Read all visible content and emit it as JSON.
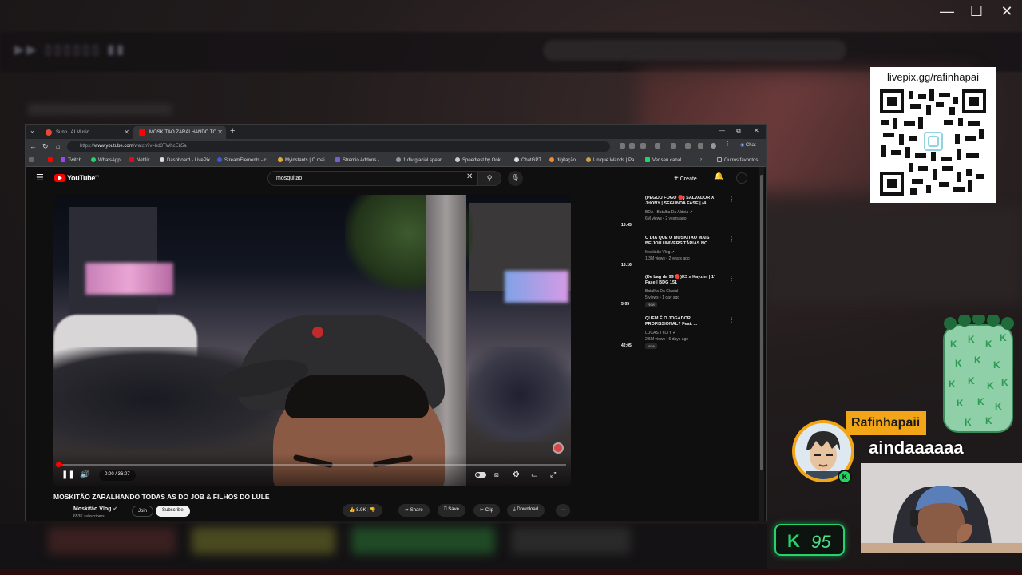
{
  "window_controls": {
    "minimize": "—",
    "maximize": "☐",
    "close": "✕"
  },
  "browser": {
    "tabs": [
      {
        "title": "Suno | AI Music",
        "active": false,
        "favicon_color": "#e24a3a"
      },
      {
        "title": "MOSKITÃO ZARALHANDO TO",
        "active": true,
        "favicon_color": "#ff0000"
      }
    ],
    "tab_close": "✕",
    "new_tab": "+",
    "url_prefix": "https://",
    "url_host": "www.youtube.com",
    "url_rest": "/watch?v=hd3TWhcEb5a",
    "chat_label": "Chat",
    "bookmarks": [
      {
        "label": "",
        "color": "#ff0000"
      },
      {
        "label": "Twitch",
        "color": "#9146ff"
      },
      {
        "label": "WhatsApp",
        "color": "#25d366"
      },
      {
        "label": "Netflix",
        "color": "#e50914"
      },
      {
        "label": "Dashboard - LivePix",
        "color": "#dddddd"
      },
      {
        "label": "StreamElements - c...",
        "color": "#3a5bdc"
      },
      {
        "label": "Myinstants | O mai...",
        "color": "#e2a83a"
      },
      {
        "label": "Stremio Addons -...",
        "color": "#7b5bd6"
      },
      {
        "label": "1 div glacial spear...",
        "color": "#8899aa"
      },
      {
        "label": "Speedtest by Ookl...",
        "color": "#cccccc"
      },
      {
        "label": "ChatGPT",
        "color": "#dddddd"
      },
      {
        "label": "digitação",
        "color": "#f08a2a"
      },
      {
        "label": "Unique Wands | Pa...",
        "color": "#c9a24a"
      },
      {
        "label": "Ver seu canal",
        "color": "#22d46a"
      },
      {
        "label": "Outros favoritos",
        "color": "#888888"
      }
    ]
  },
  "youtube": {
    "logo_text": "YouTube",
    "logo_region": "BR",
    "search_query": "mosquitao",
    "create_label": "Create",
    "video": {
      "time": "0:00 / 36:07",
      "progress": 0.01,
      "title": "MOSKITÃO ZARALHANDO TODAS AS DO JOB & FILHOS DO LULE",
      "channel_name": "Moskitão Vlog",
      "channel_subs": "653K subscribers",
      "join_label": "Join",
      "subscribe_label": "Subscribe",
      "likes": "8.9K",
      "share_label": "Share",
      "save_label": "Save",
      "clip_label": "Clip",
      "download_label": "Download"
    },
    "recommendations": [
      {
        "title": "(PEGOU FOGO 🔴) SALVADOR X JHONY | SEGUNDA FASE | (4...",
        "channel": "BDA - Batalha Da Aldeia",
        "meta": "6M views • 2 years ago",
        "duration": "15:45",
        "is_new": false
      },
      {
        "title": "O DIA QUE O MOSKITAO MAIS BEIJOU UNIVERSITÁRIAS NO ...",
        "channel": "Moskitão Vlog",
        "meta": "1.3M views • 2 years ago",
        "duration": "18:16",
        "is_new": false
      },
      {
        "title": "(De bag da 99 🔴)K3 x Kayzim | 1° Fase | BDG 151",
        "channel": "Batalha Da Glacial",
        "meta": "5 views • 1 day ago",
        "duration": "5:05",
        "is_new": true
      },
      {
        "title": "QUEM É O JOGADOR PROFISSIONAL? Feat. ...",
        "channel": "LUCAS TYLTY",
        "meta": "2.5M views • 6 days ago",
        "duration": "42:05",
        "is_new": true
      }
    ],
    "new_badge": "New"
  },
  "overlay": {
    "livepix_label": "livepix.gg/rafinhapai",
    "chat_user": "Rafinhapaii",
    "chat_message": "aindaaaaaa",
    "kick_icon": "K",
    "viewer_count": "95"
  }
}
